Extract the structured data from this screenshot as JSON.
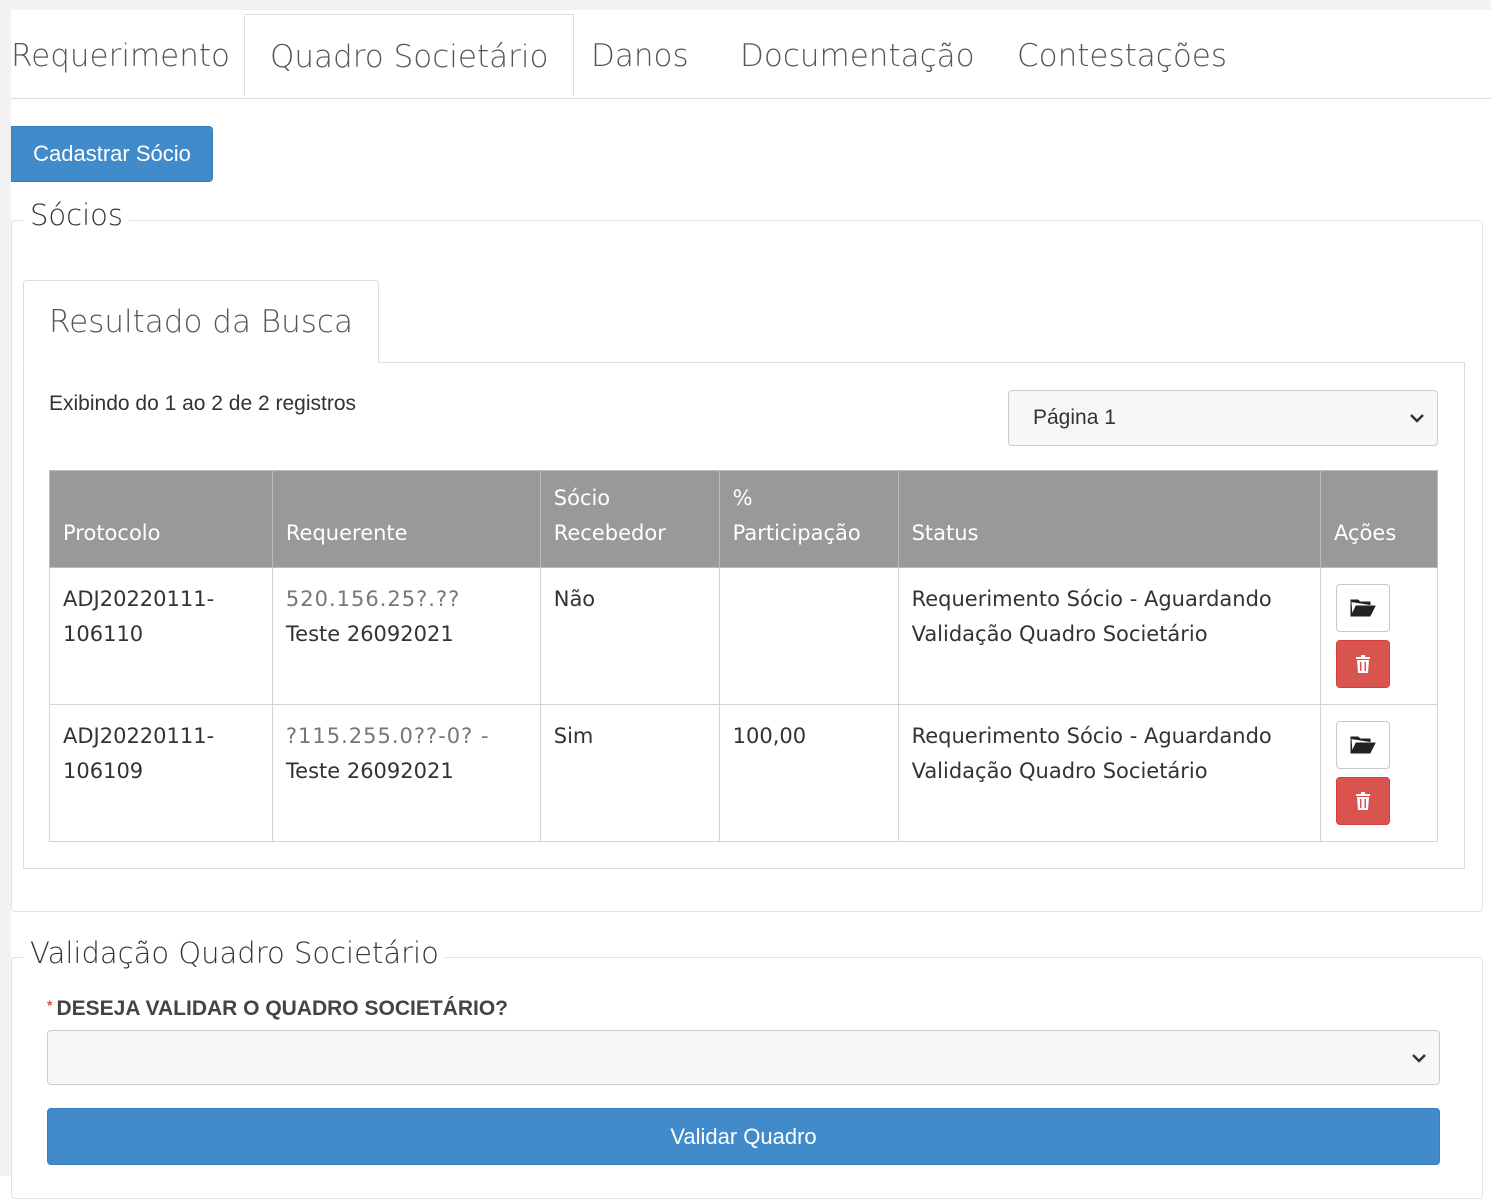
{
  "tabs": [
    {
      "label": "Requerimento"
    },
    {
      "label": "Quadro Societário",
      "active": true
    },
    {
      "label": "Danos"
    },
    {
      "label": "Documentação"
    },
    {
      "label": "Contestações"
    }
  ],
  "cadastrar_button": "Cadastrar Sócio",
  "socios": {
    "legend": "Sócios",
    "result_tab": "Resultado da Busca",
    "records_info": "Exibindo do 1 ao 2 de 2 registros",
    "page_select": "Página 1",
    "columns": {
      "protocolo": "Protocolo",
      "requerente": "Requerente",
      "socio_recebedor_1": "Sócio",
      "socio_recebedor_2": "Recebedor",
      "participacao_1": "%",
      "participacao_2": "Participação",
      "status": "Status",
      "acoes": "Ações"
    },
    "rows": [
      {
        "protocolo_1": "ADJ20220111-",
        "protocolo_2": "106110",
        "requerente_doc": "520.156.25?.??",
        "requerente_name": "Teste 26092021",
        "socio_recebedor": "Não",
        "participacao": "",
        "status_1": "Requerimento Sócio - Aguardando",
        "status_2": "Validação Quadro Societário"
      },
      {
        "protocolo_1": "ADJ20220111-",
        "protocolo_2": "106109",
        "requerente_doc": "?115.255.0??-0? -",
        "requerente_name": "Teste 26092021",
        "socio_recebedor": "Sim",
        "participacao": "100,00",
        "status_1": "Requerimento Sócio - Aguardando",
        "status_2": "Validação Quadro Societário"
      }
    ]
  },
  "validacao": {
    "legend": "Validação Quadro Societário",
    "question": "DESEJA VALIDAR O QUADRO SOCIETÁRIO?",
    "required_mark": "*",
    "select_value": "",
    "button": "Validar Quadro"
  },
  "colors": {
    "primary": "#428bca",
    "danger": "#d9534f",
    "table_header": "#999999"
  }
}
